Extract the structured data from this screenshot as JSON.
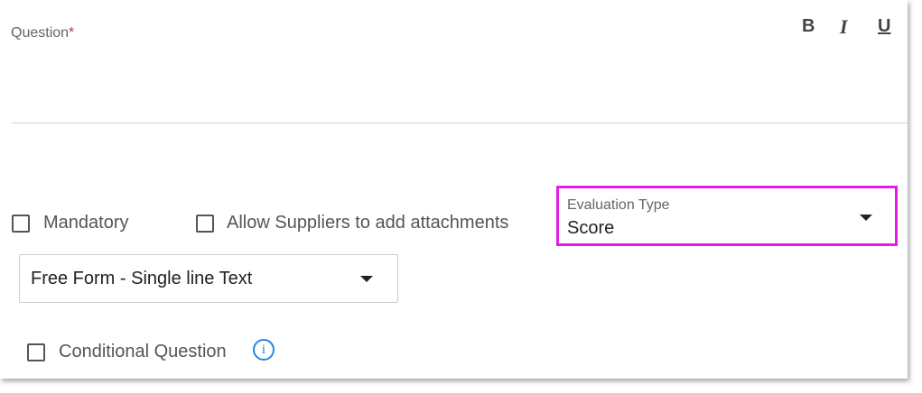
{
  "question": {
    "label": "Question",
    "required_marker": "*"
  },
  "toolbar": {
    "bold_label": "B",
    "italic_label": "I",
    "underline_label": "U"
  },
  "options": {
    "mandatory_label": "Mandatory",
    "mandatory_checked": false,
    "allow_attachments_label": "Allow Suppliers to add attachments",
    "allow_attachments_checked": false,
    "conditional_label": "Conditional Question",
    "conditional_checked": false
  },
  "evaluation_type": {
    "label": "Evaluation Type",
    "value": "Score",
    "highlight_color": "#e51ce5"
  },
  "response_type": {
    "value": "Free Form - Single line Text"
  },
  "info_icon": {
    "glyph": "i",
    "color": "#1e88e5"
  }
}
